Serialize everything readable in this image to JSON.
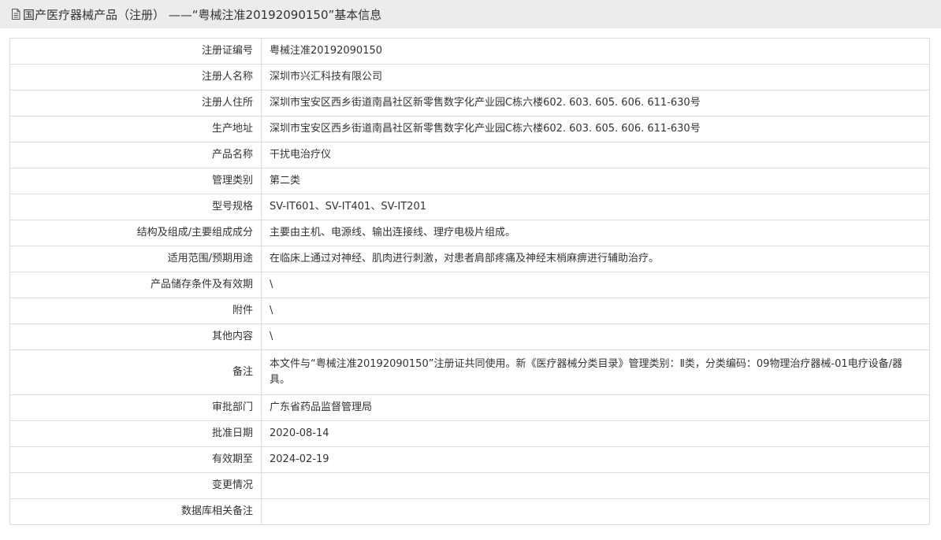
{
  "header": {
    "title": "国产医疗器械产品（注册） ——“粤械注准20192090150”基本信息",
    "icon": "document-icon"
  },
  "rows": [
    {
      "label": "注册证编号",
      "value": "粤械注准20192090150"
    },
    {
      "label": "注册人名称",
      "value": "深圳市兴汇科技有限公司"
    },
    {
      "label": "注册人住所",
      "value": "深圳市宝安区西乡街道南昌社区新零售数字化产业园C栋六楼602. 603. 605. 606. 611-630号"
    },
    {
      "label": "生产地址",
      "value": "深圳市宝安区西乡街道南昌社区新零售数字化产业园C栋六楼602. 603. 605. 606. 611-630号"
    },
    {
      "label": "产品名称",
      "value": "干扰电治疗仪"
    },
    {
      "label": "管理类别",
      "value": "第二类"
    },
    {
      "label": "型号规格",
      "value": "SV-IT601、SV-IT401、SV-IT201"
    },
    {
      "label": "结构及组成/主要组成成分",
      "value": "主要由主机、电源线、输出连接线、理疗电极片组成。"
    },
    {
      "label": "适用范围/预期用途",
      "value": "在临床上通过对神经、肌肉进行刺激，对患者肩部疼痛及神经末梢麻痹进行辅助治疗。"
    },
    {
      "label": "产品储存条件及有效期",
      "value": "\\"
    },
    {
      "label": "附件",
      "value": "\\"
    },
    {
      "label": "其他内容",
      "value": "\\"
    },
    {
      "label": "备注",
      "value": "本文件与“粤械注准20192090150”注册证共同使用。新《医疗器械分类目录》管理类别：Ⅱ类，分类编码：09物理治疗器械-01电疗设备/器具。"
    },
    {
      "label": "审批部门",
      "value": "广东省药品监督管理局"
    },
    {
      "label": "批准日期",
      "value": "2020-08-14"
    },
    {
      "label": "有效期至",
      "value": "2024-02-19"
    },
    {
      "label": "变更情况",
      "value": ""
    },
    {
      "label": "数据库相关备注",
      "value": ""
    }
  ]
}
